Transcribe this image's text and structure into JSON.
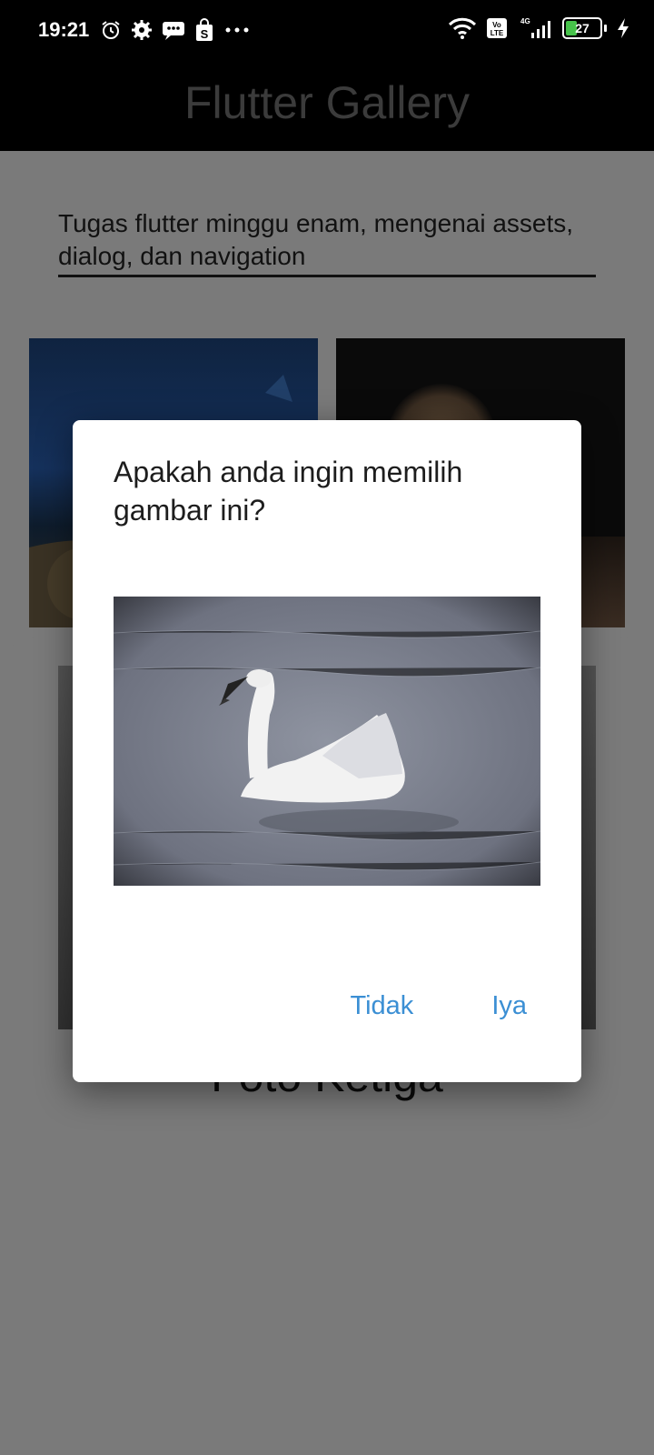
{
  "status_bar": {
    "time": "19:21",
    "battery": "27",
    "network": "4G",
    "volte": "Vo LTE"
  },
  "app_bar": {
    "title": "Flutter Gallery"
  },
  "content": {
    "description": "Tugas flutter minggu enam, mengenai assets, dialog, dan navigation",
    "sheet_label": "Foto Ketiga"
  },
  "dialog": {
    "title": "Apakah anda ingin memilih gambar ini?",
    "actions": {
      "no": "Tidak",
      "yes": "Iya"
    }
  },
  "colors": {
    "accent": "#3b8fd4",
    "status_bar": "#000000",
    "background": "#7a7a7a"
  }
}
